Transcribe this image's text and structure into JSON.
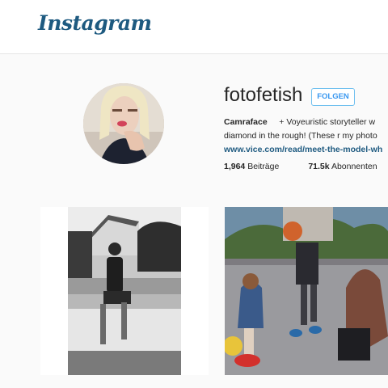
{
  "header": {
    "logo_text": "Instagram"
  },
  "profile": {
    "username": "fotofetish",
    "follow_label": "FOLGEN",
    "bio_name": "Camraface",
    "bio_text_1": "+ Voyeuristic storyteller w",
    "bio_text_2": "diamond in the rough! (These r my photo",
    "bio_link": "www.vice.com/read/meet-the-model-wh",
    "posts_count": "1,964",
    "posts_label": "Beiträge",
    "followers_count": "71.5k",
    "followers_label": "Abonnenten"
  },
  "colors": {
    "accent": "#3897f0",
    "logo": "#1e5a80"
  }
}
